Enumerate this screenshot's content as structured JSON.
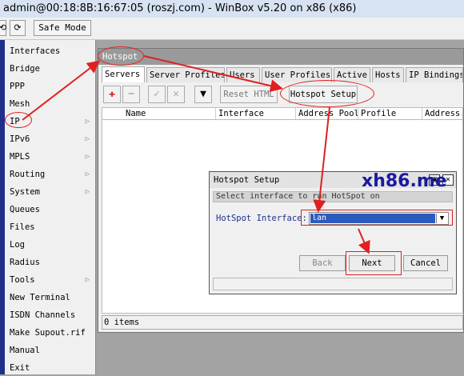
{
  "window_title": "admin@00:18:8B:16:67:05 (roszj.com) - WinBox v5.20 on x86 (x86)",
  "toolbar": {
    "undo_icon": "undo-icon",
    "redo_icon": "redo-icon",
    "safe_mode": "Safe Mode"
  },
  "sidebar": {
    "items": [
      {
        "label": "Interfaces",
        "submenu": false
      },
      {
        "label": "Bridge",
        "submenu": false
      },
      {
        "label": "PPP",
        "submenu": false
      },
      {
        "label": "Mesh",
        "submenu": false
      },
      {
        "label": "IP",
        "submenu": true
      },
      {
        "label": "IPv6",
        "submenu": true
      },
      {
        "label": "MPLS",
        "submenu": true
      },
      {
        "label": "Routing",
        "submenu": true
      },
      {
        "label": "System",
        "submenu": true
      },
      {
        "label": "Queues",
        "submenu": false
      },
      {
        "label": "Files",
        "submenu": false
      },
      {
        "label": "Log",
        "submenu": false
      },
      {
        "label": "Radius",
        "submenu": false
      },
      {
        "label": "Tools",
        "submenu": true
      },
      {
        "label": "New Terminal",
        "submenu": false
      },
      {
        "label": "ISDN Channels",
        "submenu": false
      },
      {
        "label": "Make Supout.rif",
        "submenu": false
      },
      {
        "label": "Manual",
        "submenu": false
      },
      {
        "label": "Exit",
        "submenu": false
      }
    ]
  },
  "hotspot": {
    "title": "Hotspot",
    "tabs": [
      "Servers",
      "Server Profiles",
      "Users",
      "User Profiles",
      "Active",
      "Hosts",
      "IP Bindings"
    ],
    "active_tab": "Servers",
    "reset_html": "Reset HTML",
    "hotspot_setup": "Hotspot Setup",
    "columns": [
      "Name",
      "Interface",
      "Address Pool",
      "Profile",
      "Address..."
    ],
    "status": "0 items"
  },
  "dialog": {
    "title": "Hotspot Setup",
    "hint": "Select interface to run HotSpot on",
    "interface_label": "HotSpot Interface:",
    "interface_value": "lan",
    "back": "Back",
    "next": "Next",
    "cancel": "Cancel"
  },
  "watermark": "xh86.me",
  "colors": {
    "annotation_red": "#e02020",
    "sidebar_stripe": "#1f2f8a",
    "selection_blue": "#2c5bbf"
  }
}
